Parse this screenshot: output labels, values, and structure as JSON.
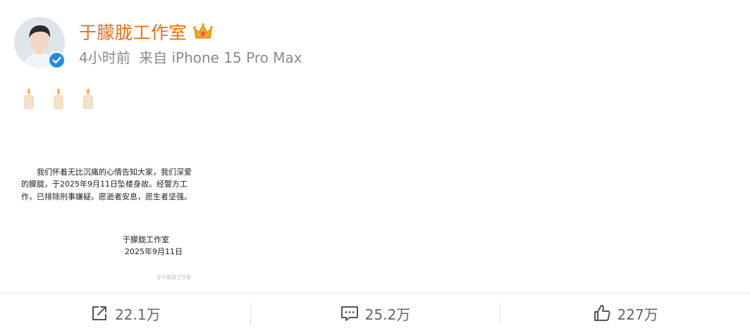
{
  "post": {
    "username": "于朦胧工作室",
    "time_ago": "4小时前",
    "source": "来自 iPhone 15 Pro Max",
    "emoji_count_label": "🕯️🕯️🕯️",
    "badge_icon": "crown-icon",
    "verified_icon": "verified-icon"
  },
  "notice": {
    "body": "我们怀着无比沉痛的心情告知大家，我们深爱的朦胧，于2025年9月11日坠楼身故。经警方工作，已排除刑事嫌疑。愿逝者安息，愿生者坚强。",
    "signature": "于朦胧工作室",
    "date": "2025年9月11日",
    "watermark": "@于朦胧工作室"
  },
  "actions": {
    "repost_count": "22.1万",
    "comment_count": "25.2万",
    "like_count": "227万"
  },
  "colors": {
    "username": "#f36d10",
    "meta": "#8a8a8a",
    "verified": "#1e8ce6",
    "action_text": "#666666"
  }
}
